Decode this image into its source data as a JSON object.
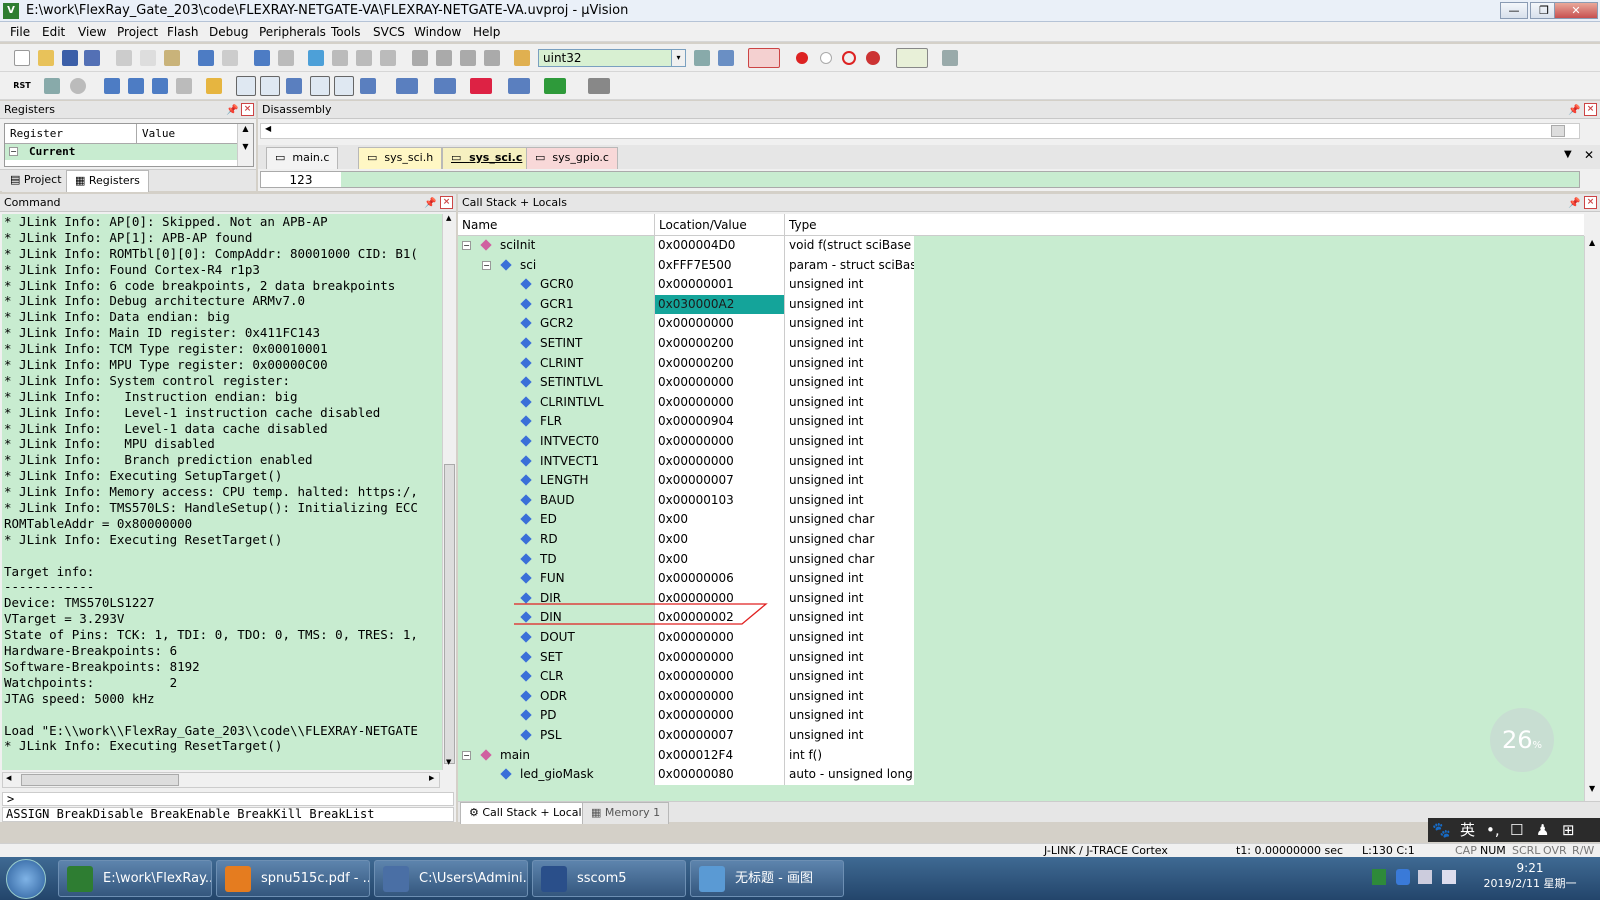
{
  "window": {
    "title": "E:\\work\\FlexRay_Gate_203\\code\\FLEXRAY-NETGATE-VA\\FLEXRAY-NETGATE-VA.uvproj - µVision",
    "app_icon_text": "V",
    "min_label": "—",
    "max_label": "❐",
    "close_label": "✕"
  },
  "menu": [
    "File",
    "Edit",
    "View",
    "Project",
    "Flash",
    "Debug",
    "Peripherals",
    "Tools",
    "SVCS",
    "Window",
    "Help"
  ],
  "toolbar": {
    "combo_value": "uint32",
    "combo_arrow": "▾",
    "rst_label": "RST"
  },
  "registers_panel": {
    "title": "Registers",
    "col_register": "Register",
    "col_value": "Value",
    "current_label": "Current",
    "tab_project": "Project",
    "tab_registers": "Registers"
  },
  "disassembly_panel": {
    "title": "Disassembly",
    "tabs": [
      "main.c",
      "sys_sci.h",
      "sys_sci.c",
      "sys_gpio.c"
    ],
    "line_no": "123"
  },
  "command_panel": {
    "title": "Command",
    "lines": [
      "* JLink Info: AP[0]: Skipped. Not an APB-AP",
      "* JLink Info: AP[1]: APB-AP found",
      "* JLink Info: ROMTbl[0][0]: CompAddr: 80001000 CID: B1(",
      "* JLink Info: Found Cortex-R4 r1p3",
      "* JLink Info: 6 code breakpoints, 2 data breakpoints",
      "* JLink Info: Debug architecture ARMv7.0",
      "* JLink Info: Data endian: big",
      "* JLink Info: Main ID register: 0x411FC143",
      "* JLink Info: TCM Type register: 0x00010001",
      "* JLink Info: MPU Type register: 0x00000C00",
      "* JLink Info: System control register:",
      "* JLink Info:   Instruction endian: big",
      "* JLink Info:   Level-1 instruction cache disabled",
      "* JLink Info:   Level-1 data cache disabled",
      "* JLink Info:   MPU disabled",
      "* JLink Info:   Branch prediction enabled",
      "* JLink Info: Executing SetupTarget()",
      "* JLink Info: Memory access: CPU temp. halted: https:/,",
      "* JLink Info: TMS570LS: HandleSetup(): Initializing ECC",
      "ROMTableAddr = 0x80000000",
      "* JLink Info: Executing ResetTarget()",
      "",
      "Target info:",
      "------------",
      "Device: TMS570LS1227",
      "VTarget = 3.293V",
      "State of Pins: TCK: 1, TDI: 0, TDO: 0, TMS: 0, TRES: 1,",
      "Hardware-Breakpoints: 6",
      "Software-Breakpoints: 8192",
      "Watchpoints:          2",
      "JTAG speed: 5000 kHz",
      "",
      "Load \"E:\\\\work\\\\FlexRay_Gate_203\\\\code\\\\FLEXRAY-NETGATE",
      "* JLink Info: Executing ResetTarget()"
    ],
    "prompt": ">",
    "hint": "ASSIGN BreakDisable BreakEnable BreakKill BreakList"
  },
  "callstack_panel": {
    "title": "Call Stack + Locals",
    "col_name": "Name",
    "col_value": "Location/Value",
    "col_type": "Type",
    "rows": [
      {
        "name": "sciInit",
        "value": "0x000004D0",
        "type": "void f(struct sciBase *)",
        "level": 0,
        "exp": "−"
      },
      {
        "name": "sci",
        "value": "0xFFF7E500",
        "type": "param - struct sciBase *",
        "level": 1,
        "exp": "−"
      },
      {
        "name": "GCR0",
        "value": "0x00000001",
        "type": "unsigned int",
        "level": 2
      },
      {
        "name": "GCR1",
        "value": "0x030000A2",
        "type": "unsigned int",
        "level": 2,
        "highlight": true
      },
      {
        "name": "GCR2",
        "value": "0x00000000",
        "type": "unsigned int",
        "level": 2
      },
      {
        "name": "SETINT",
        "value": "0x00000200",
        "type": "unsigned int",
        "level": 2
      },
      {
        "name": "CLRINT",
        "value": "0x00000200",
        "type": "unsigned int",
        "level": 2
      },
      {
        "name": "SETINTLVL",
        "value": "0x00000000",
        "type": "unsigned int",
        "level": 2
      },
      {
        "name": "CLRINTLVL",
        "value": "0x00000000",
        "type": "unsigned int",
        "level": 2
      },
      {
        "name": "FLR",
        "value": "0x00000904",
        "type": "unsigned int",
        "level": 2
      },
      {
        "name": "INTVECT0",
        "value": "0x00000000",
        "type": "unsigned int",
        "level": 2
      },
      {
        "name": "INTVECT1",
        "value": "0x00000000",
        "type": "unsigned int",
        "level": 2
      },
      {
        "name": "LENGTH",
        "value": "0x00000007",
        "type": "unsigned int",
        "level": 2
      },
      {
        "name": "BAUD",
        "value": "0x00000103",
        "type": "unsigned int",
        "level": 2
      },
      {
        "name": "ED",
        "value": "0x00",
        "type": "unsigned char",
        "level": 2
      },
      {
        "name": "RD",
        "value": "0x00",
        "type": "unsigned char",
        "level": 2
      },
      {
        "name": "TD",
        "value": "0x00",
        "type": "unsigned char",
        "level": 2
      },
      {
        "name": "FUN",
        "value": "0x00000006",
        "type": "unsigned int",
        "level": 2
      },
      {
        "name": "DIR",
        "value": "0x00000000",
        "type": "unsigned int",
        "level": 2
      },
      {
        "name": "DIN",
        "value": "0x00000002",
        "type": "unsigned int",
        "level": 2,
        "annotated": true
      },
      {
        "name": "DOUT",
        "value": "0x00000000",
        "type": "unsigned int",
        "level": 2
      },
      {
        "name": "SET",
        "value": "0x00000000",
        "type": "unsigned int",
        "level": 2
      },
      {
        "name": "CLR",
        "value": "0x00000000",
        "type": "unsigned int",
        "level": 2
      },
      {
        "name": "ODR",
        "value": "0x00000000",
        "type": "unsigned int",
        "level": 2
      },
      {
        "name": "PD",
        "value": "0x00000000",
        "type": "unsigned int",
        "level": 2
      },
      {
        "name": "PSL",
        "value": "0x00000007",
        "type": "unsigned int",
        "level": 2
      },
      {
        "name": "main",
        "value": "0x000012F4",
        "type": "int f()",
        "level": 0,
        "exp": "−"
      },
      {
        "name": "led_gioMask",
        "value": "0x00000080",
        "type": "auto - unsigned long",
        "level": 1
      }
    ],
    "tab_callstack": "Call Stack + Locals",
    "tab_memory": "Memory 1",
    "badge_value": "26",
    "badge_unit": "%"
  },
  "ime_bar": {
    "paw": "🐾",
    "lang": "英",
    "punct": "•,",
    "items": [
      "☐",
      "♟",
      "⊞"
    ]
  },
  "statusbar": {
    "debugger": "J-LINK / J-TRACE Cortex",
    "time": "t1: 0.00000000 sec",
    "position": "L:130 C:1",
    "flags": [
      "CAP",
      "NUM",
      "SCRL",
      "OVR",
      "R/W"
    ]
  },
  "taskbar": {
    "items": [
      {
        "label": "E:\\work\\FlexRay...",
        "color": "#2e7d32"
      },
      {
        "label": "spnu515c.pdf - ...",
        "color": "#e57c1f"
      },
      {
        "label": "C:\\Users\\Admini...",
        "color": "#4a6fa5"
      },
      {
        "label": "sscom5",
        "color": "#2a4f8a"
      },
      {
        "label": "无标题 - 画图",
        "color": "#5a9ad4"
      }
    ],
    "clock_time": "9:21",
    "clock_date": "2019/2/11 星期一"
  }
}
